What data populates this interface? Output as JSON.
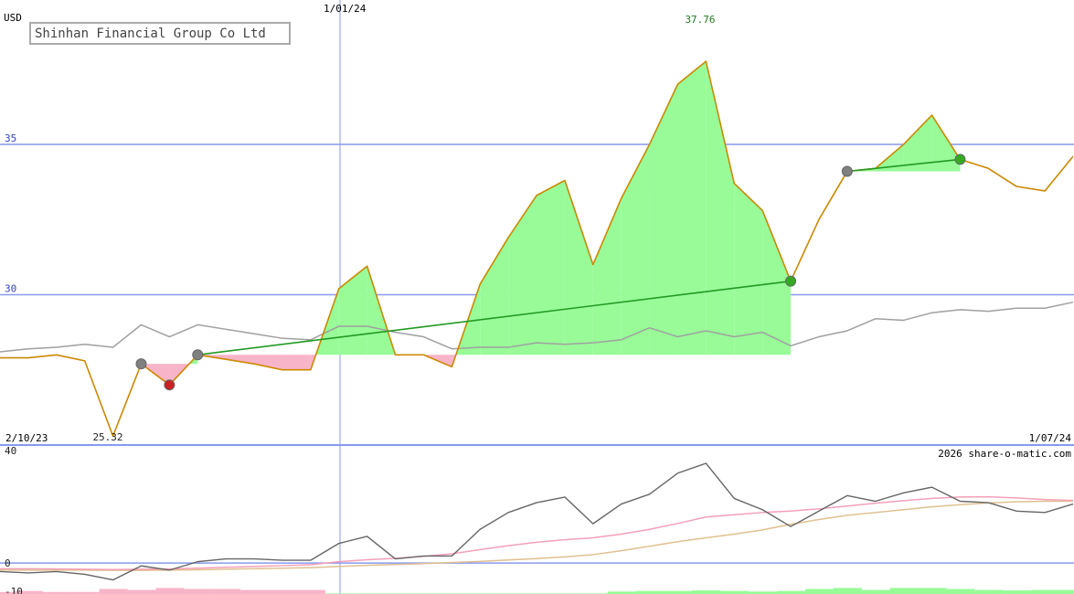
{
  "chart_data": {
    "type": "line",
    "title": "Shinhan Financial Group Co Ltd",
    "currency": "USD",
    "x_start_label": "2/10/23",
    "x_mid_label": "1/01/24",
    "x_end_label": "1/07/24",
    "watermark": "2026 share-o-matic.com",
    "price_axis": {
      "ticks": [
        30,
        35
      ],
      "tick_labels": [
        "30",
        "35"
      ],
      "ylim": [
        25.0,
        39.8
      ]
    },
    "indicator_axis": {
      "ticks": [
        40,
        0,
        -10
      ],
      "tick_labels": [
        "40",
        "0",
        "-10"
      ],
      "ylim": [
        -11,
        42
      ]
    },
    "max_label": "37.76",
    "min_label": "25.32",
    "price": [
      27.9,
      27.9,
      28.0,
      27.8,
      25.3,
      27.7,
      27.0,
      28.0,
      27.85,
      27.7,
      27.5,
      27.5,
      30.2,
      30.95,
      28.0,
      28.0,
      27.6,
      30.35,
      31.9,
      33.3,
      33.8,
      31.0,
      33.2,
      35.0,
      37.0,
      37.76,
      33.7,
      32.8,
      30.45,
      32.5,
      34.1,
      34.2,
      35.0,
      35.97,
      34.5,
      34.2,
      33.6,
      33.45,
      34.6
    ],
    "comparison": [
      28.1,
      28.2,
      28.25,
      28.35,
      28.25,
      29.0,
      28.6,
      29.0,
      28.85,
      28.7,
      28.55,
      28.5,
      28.95,
      28.95,
      28.75,
      28.6,
      28.2,
      28.25,
      28.25,
      28.4,
      28.35,
      28.4,
      28.5,
      28.9,
      28.6,
      28.8,
      28.6,
      28.75,
      28.3,
      28.6,
      28.8,
      29.2,
      29.15,
      29.4,
      29.5,
      29.45,
      29.55,
      29.55,
      29.75
    ],
    "signals": [
      {
        "index": 5,
        "kind": "neutral"
      },
      {
        "index": 6,
        "kind": "sell"
      },
      {
        "index": 7,
        "kind": "neutral"
      },
      {
        "index": 28,
        "kind": "buy"
      },
      {
        "index": 30,
        "kind": "neutral"
      },
      {
        "index": 34,
        "kind": "buy"
      }
    ],
    "trend_lines": [
      {
        "from": 7,
        "to": 28
      },
      {
        "from": 30,
        "to": 34
      }
    ],
    "momentum": [
      -3,
      -3.5,
      -3,
      -4,
      -6,
      -1,
      -2.5,
      0.5,
      1.5,
      1.5,
      1,
      1,
      7,
      9.5,
      1.5,
      2.5,
      2.5,
      12,
      18,
      21.5,
      23.5,
      14,
      21,
      24.5,
      32,
      35.5,
      23,
      19,
      13,
      18.5,
      24,
      22,
      25,
      27,
      22,
      21.5,
      18.5,
      18,
      21
    ],
    "signal_line": [
      -2,
      -2,
      -2.1,
      -2.2,
      -2.3,
      -2.2,
      -2.1,
      -1.8,
      -1.5,
      -1.2,
      -0.9,
      -0.6,
      0.5,
      1.2,
      1.7,
      2.4,
      3.3,
      4.8,
      6.2,
      7.4,
      8.3,
      9,
      10.3,
      12,
      14.1,
      16.4,
      17.2,
      18,
      18.5,
      19.3,
      20.3,
      21.3,
      22.2,
      23,
      23.5,
      23.6,
      23.2,
      22.6,
      22.3
    ],
    "long_signal": [
      -2.5,
      -2.5,
      -2.5,
      -2.5,
      -2.6,
      -2.6,
      -2.5,
      -2.4,
      -2.2,
      -2,
      -1.8,
      -1.6,
      -1.2,
      -0.8,
      -0.5,
      -0.2,
      0.2,
      0.6,
      1.1,
      1.6,
      2.2,
      3,
      4.4,
      6,
      7.6,
      9,
      10.3,
      11.8,
      13.8,
      15.5,
      17,
      18,
      19,
      20,
      20.8,
      21.4,
      21.8,
      22,
      22
    ],
    "histogram": [
      -1.0,
      -1.5,
      -1.0,
      -1.0,
      -2.5,
      -2.0,
      -3.0,
      -2.5,
      -2.5,
      -2.0,
      -2.0,
      -2.0,
      0.3,
      0.3,
      0.3,
      0.3,
      0.3,
      0.3,
      0.3,
      0.3,
      0.3,
      0.3,
      1.2,
      1.5,
      1.5,
      1.8,
      1.5,
      1.2,
      1.5,
      2.5,
      3.0,
      2.0,
      3.0,
      3.0,
      2.5,
      2.0,
      1.8,
      2.0,
      2.0
    ],
    "colors": {
      "price": "#cc8800",
      "comparison": "#a0a0a0",
      "gain_fill": "#98fb98",
      "loss_fill": "#f8b4c8",
      "trend": "#229922",
      "buy": "#33aa22",
      "sell": "#cc2222",
      "neutral": "#808080",
      "grid": "#8899ee",
      "axis_text": "#3344bb",
      "momentum": "#666666",
      "signal_line": "#f4a0b8",
      "long_signal": "#e0c090",
      "max_text": "#227722"
    }
  }
}
